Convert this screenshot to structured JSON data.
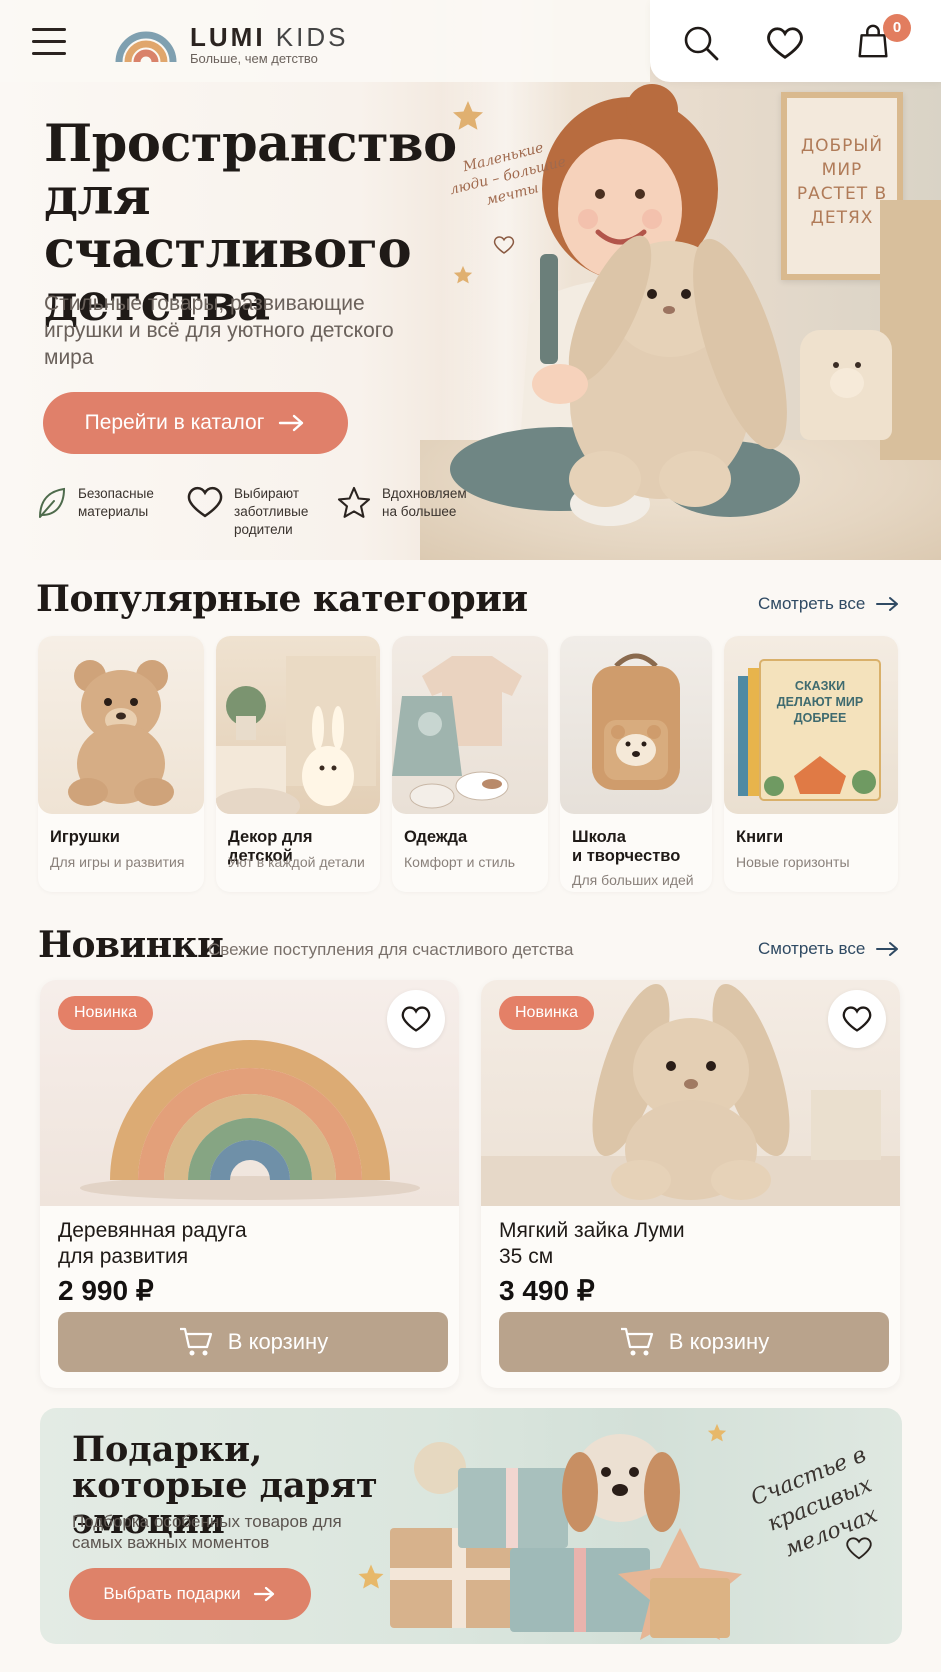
{
  "header": {
    "brand_bold": "LUMI",
    "brand_light": "KIDS",
    "tagline": "Больше, чем детство",
    "cart_count": "0"
  },
  "hero": {
    "title": "Пространство для счастливого детства",
    "subtitle": "Стильные товары, развивающие игрушки и всё для уютного детского мира",
    "cta_label": "Перейти в каталог",
    "handwritten": "Маленькие люди – большие мечты",
    "poster_text": "ДОБРЫЙ МИР РАСТЕТ В ДЕТЯХ",
    "perks": [
      {
        "icon": "leaf-icon",
        "text_line1": "Безопасные",
        "text_line2": "материалы",
        "text_line3": ""
      },
      {
        "icon": "heart-icon",
        "text_line1": "Выбирают",
        "text_line2": "заботливые",
        "text_line3": "родители"
      },
      {
        "icon": "star-icon",
        "text_line1": "Вдохновляем",
        "text_line2": "на большее",
        "text_line3": ""
      }
    ]
  },
  "categories": {
    "title": "Популярные категории",
    "see_all": "Смотреть все",
    "items": [
      {
        "name": "Игрушки",
        "name2": "",
        "desc": "Для игры и развития"
      },
      {
        "name": "Декор для детской",
        "name2": "",
        "desc": "Уют в каждой детали"
      },
      {
        "name": "Одежда",
        "name2": "",
        "desc": "Комфорт и стиль"
      },
      {
        "name": "Школа",
        "name2": "и творчество",
        "desc": "Для больших идей"
      },
      {
        "name": "Книги",
        "name2": "",
        "desc": "Новые горизонты"
      }
    ],
    "book_cover": "СКАЗКИ ДЕЛАЮТ МИР ДОБРЕЕ"
  },
  "new_arrivals": {
    "title": "Новинки",
    "subtitle": "Свежие поступления для счастливого детства",
    "see_all": "Смотреть все",
    "products": [
      {
        "badge": "Новинка",
        "name_line1": "Деревянная радуга",
        "name_line2": "для развития",
        "price": "2 990 ₽",
        "button": "В корзину"
      },
      {
        "badge": "Новинка",
        "name_line1": "Мягкий зайка Луми",
        "name_line2": "35 см",
        "price": "3 490 ₽",
        "button": "В корзину"
      }
    ]
  },
  "gift_banner": {
    "title": "Подарки, которые дарят эмоции",
    "subtitle": "Подборка особенных товаров для самых важных моментов",
    "button": "Выбрать подарки",
    "handwritten": "Счастье в красивых мелочах"
  },
  "colors": {
    "accent": "#e0806a",
    "button_neutral": "#b9a38c",
    "link": "#2f4a63",
    "background": "#fbf8f4"
  }
}
